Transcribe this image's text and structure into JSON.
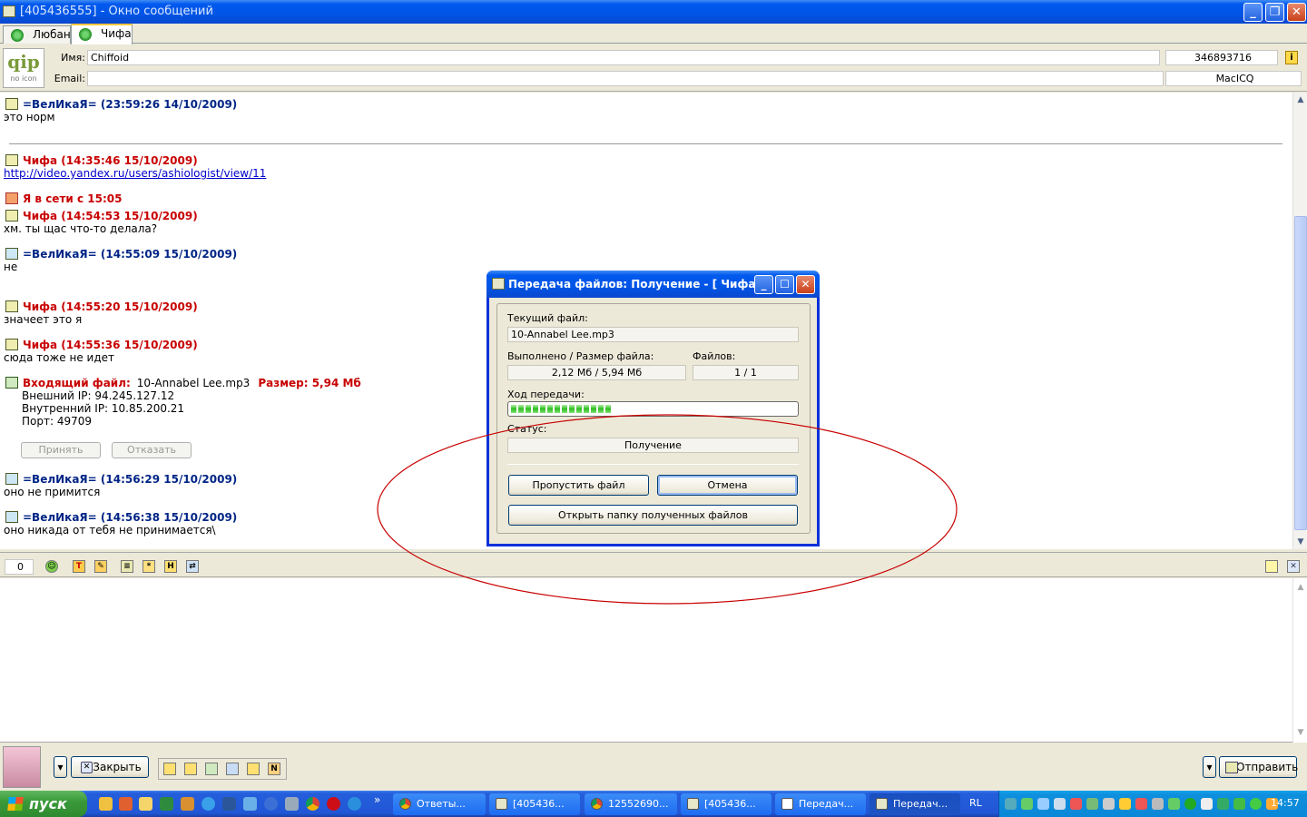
{
  "window": {
    "title": "[405436555] - Окно сообщений"
  },
  "tabs": [
    {
      "label": "Любаня",
      "active": false
    },
    {
      "label": "Чифа",
      "active": true
    }
  ],
  "contact": {
    "logo_text": "qip",
    "logo_sub": "no icon",
    "name_label": "Имя:",
    "name_value": "Chiffoid",
    "uin": "346893716",
    "email_label": "Email:",
    "email_value": "",
    "client": "MacICQ"
  },
  "messages": [
    {
      "header": "=ВелИкаЯ= (23:59:26 14/10/2009)",
      "color": "blue",
      "text": "это норм"
    },
    {
      "header": "Чифа (14:35:46 15/10/2009)",
      "color": "red",
      "link": "http://video.yandex.ru/users/ashiologist/view/11"
    },
    {
      "header": "Я в сети с 15:05",
      "color": "red"
    },
    {
      "header": "Чифа (14:54:53 15/10/2009)",
      "color": "red",
      "text": "хм. ты щас что-то делала?"
    },
    {
      "header": "=ВелИкаЯ= (14:55:09 15/10/2009)",
      "color": "blue",
      "text": "не"
    },
    {
      "header": "Чифа (14:55:20 15/10/2009)",
      "color": "red",
      "text": "значеет это я"
    },
    {
      "header": "Чифа (14:55:36 15/10/2009)",
      "color": "red",
      "text": "сюда тоже не идет"
    },
    {
      "header": "=ВелИкаЯ= (14:56:29 15/10/2009)",
      "color": "blue",
      "text": "оно не примится"
    },
    {
      "header": "=ВелИкаЯ= (14:56:38 15/10/2009)",
      "color": "blue",
      "text": "оно никада от тебя не принимается\\"
    }
  ],
  "incoming_file": {
    "label": "Входящий файл:",
    "filename": "10-Annabel Lee.mp3",
    "size": "Размер: 5,94 Мб",
    "external_ip": "Внешний IP: 94.245.127.12",
    "internal_ip": "Внутренний IP: 10.85.200.21",
    "port": "Порт: 49709",
    "accept": "Принять",
    "decline": "Отказать"
  },
  "toolbar": {
    "counter": "0"
  },
  "bottom": {
    "close": "Закрыть",
    "send": "Отправить"
  },
  "dialog": {
    "title": "Передача файлов: Получение - [ Чифа ]",
    "current_file_label": "Текущий файл:",
    "current_file": "10-Annabel Lee.mp3",
    "done_size_label": "Выполнено / Размер файла:",
    "done_size": "2,12 Мб / 5,94 Мб",
    "files_label": "Файлов:",
    "files": "1 / 1",
    "progress_label": "Ход передачи:",
    "progress_fraction": 0.36,
    "status_label": "Статус:",
    "status": "Получение",
    "skip_button": "Пропустить файл",
    "cancel_button": "Отмена",
    "open_folder_button": "Открыть папку полученных файлов"
  },
  "taskbar": {
    "start": "пуск",
    "tasks": [
      {
        "label": "Ответы..."
      },
      {
        "label": "[405436..."
      },
      {
        "label": "12552690..."
      },
      {
        "label": "[405436..."
      },
      {
        "label": "Передач..."
      },
      {
        "label": "Передач...",
        "active": true
      }
    ],
    "lang": "RL",
    "clock": "14:57"
  },
  "colors": {
    "header_blue": "#002586",
    "header_red": "#c80000",
    "annotation": "#c80000"
  }
}
